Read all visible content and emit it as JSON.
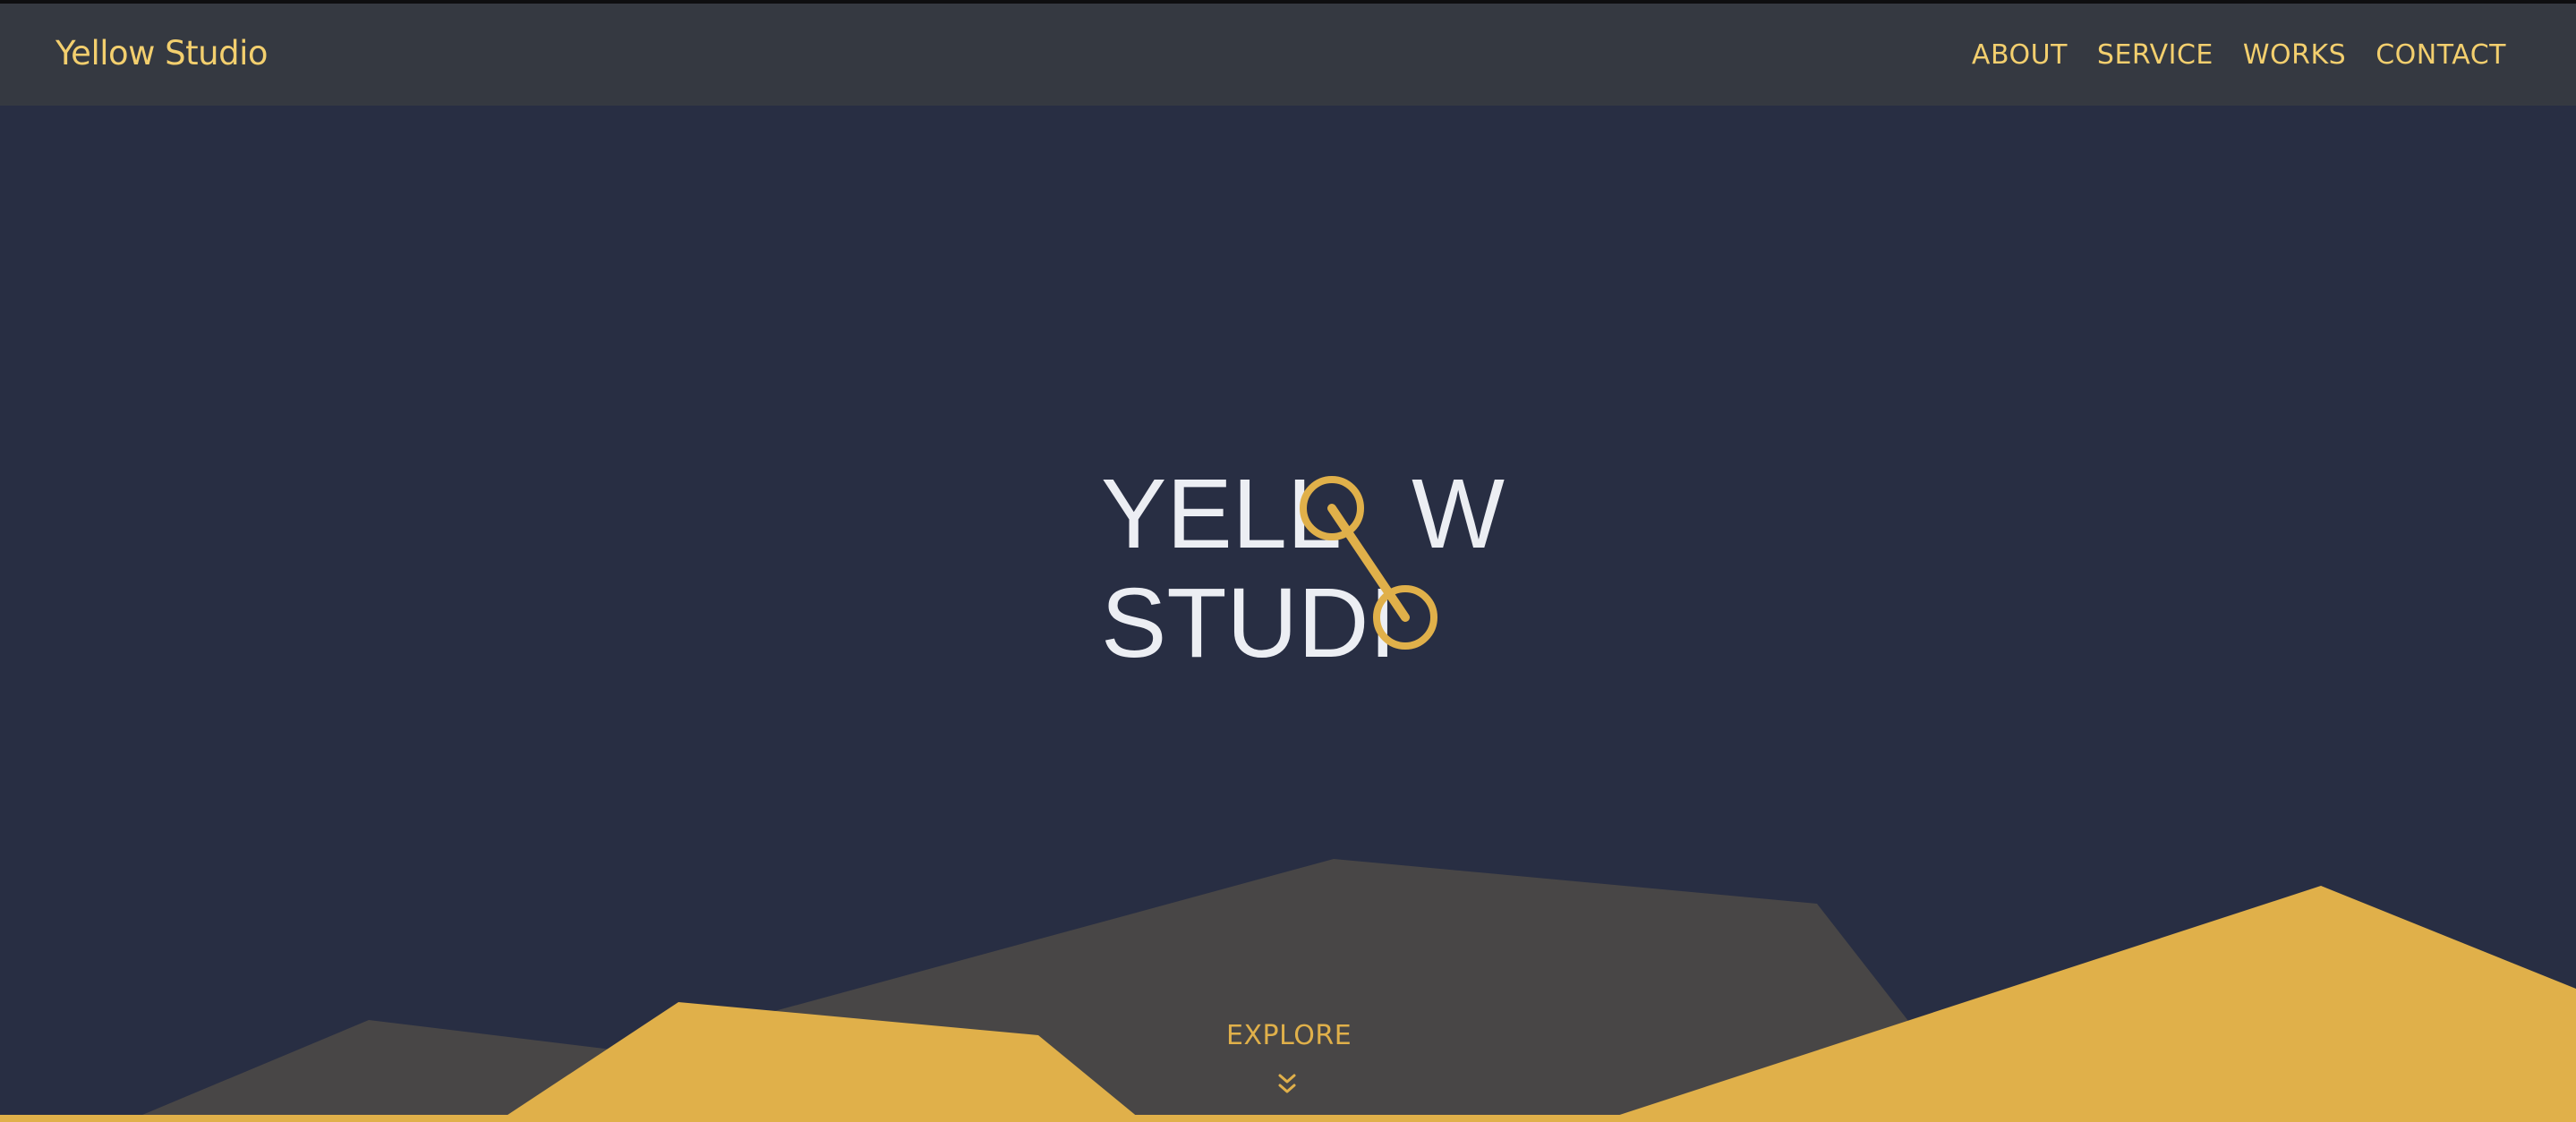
{
  "header": {
    "brand": "Yellow Studio",
    "nav": [
      {
        "label": "ABOUT"
      },
      {
        "label": "SERVICE"
      },
      {
        "label": "WORKS"
      },
      {
        "label": "CONTACT"
      }
    ]
  },
  "hero": {
    "line1": "YELL",
    "line1_tail": "W",
    "line2": "STUDI",
    "explore_label": "EXPLORE"
  },
  "colors": {
    "navbar": "#353941",
    "background": "#282e43",
    "accent": "#e0b04a",
    "nav_text": "#f3cf6e",
    "mountain_gray": "#484646",
    "logo_text": "#eceef3"
  },
  "icons": {
    "explore": "double-chevron-down-icon"
  }
}
